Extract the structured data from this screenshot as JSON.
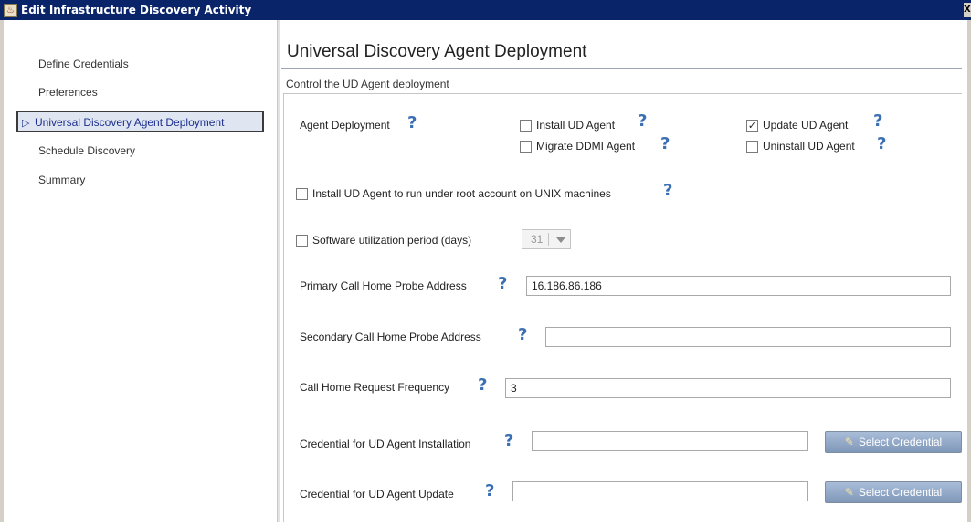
{
  "window": {
    "title": "Edit Infrastructure Discovery Activity",
    "close_glyph": "X"
  },
  "nav": {
    "items": [
      {
        "label": "Define Credentials"
      },
      {
        "label": "Preferences"
      },
      {
        "label": "Universal Discovery Agent Deployment",
        "selected": true
      },
      {
        "label": "Schedule Discovery"
      },
      {
        "label": "Summary"
      }
    ],
    "selected_arrow": "▷"
  },
  "main": {
    "title": "Universal Discovery Agent Deployment",
    "subtitle": "Control the UD Agent deployment",
    "agent_deployment": {
      "label": "Agent Deployment",
      "options": {
        "install": {
          "label": "Install UD Agent",
          "checked": false
        },
        "update": {
          "label": "Update UD Agent",
          "checked": true
        },
        "migrate": {
          "label": "Migrate DDMI Agent",
          "checked": false
        },
        "uninstall": {
          "label": "Uninstall UD Agent",
          "checked": false
        }
      }
    },
    "root_account": {
      "label": "Install UD Agent to run under root account on UNIX machines",
      "checked": false
    },
    "software_utilization": {
      "label": "Software utilization period (days)",
      "checked": false,
      "value": "31"
    },
    "primary_probe": {
      "label": "Primary Call Home Probe Address",
      "value": "16.186.86.186"
    },
    "secondary_probe": {
      "label": "Secondary Call Home Probe Address",
      "value": ""
    },
    "frequency": {
      "label": "Call Home Request Frequency",
      "value": "3"
    },
    "cred_install": {
      "label": "Credential for UD Agent Installation",
      "value": "",
      "button": "Select Credential"
    },
    "cred_update": {
      "label": "Credential for UD Agent Update",
      "value": "",
      "button": "Select Credential"
    },
    "help_glyph": "?",
    "check_glyph": "✓"
  },
  "colors": {
    "titlebar": "#0a246a",
    "selected_nav_bg": "#dfe6f2",
    "selected_nav_text": "#1c2f8c",
    "help_icon": "#3a6fb4",
    "button_gradient_top": "#a9bdd8",
    "button_gradient_bottom": "#7f97b8"
  }
}
